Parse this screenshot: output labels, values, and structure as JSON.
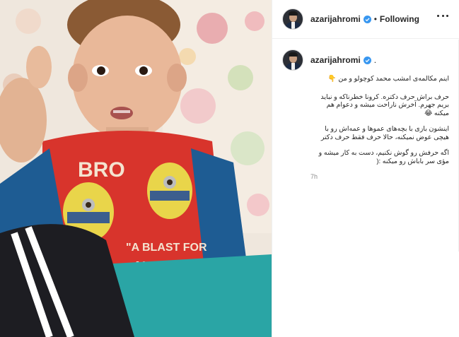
{
  "header": {
    "username": "azarijahromi",
    "separator": "•",
    "follow_status": "Following"
  },
  "post": {
    "username": "azarijahromi",
    "trailing_period": ".",
    "caption": [
      "اینم مکالمه‌ی امشب محمد کوچولو و من 👇",
      "حرف براش حرف دکتره. کرونا خطرناکه و نباید بریم جهرم. آخرش ناراحت میشه و دعوام هم میکنه 😂",
      "اینشون بازی با بچه‌های عموها و عمه‌اش رو با هیچی عوض نمیکنه، حالا حرف فقط حرف دکتر",
      "اگه حرفش رو گوش نکنیم، دست به کار میشه و مؤی سر باباش رو میکنه :("
    ],
    "timestamp": "7h"
  },
  "media": {
    "shirt_text_top": "BRO",
    "shirt_text_bottom_1": "\"A BLAST FOR",
    "shirt_text_bottom_2": "ALL AGES!\""
  },
  "colors": {
    "verified_blue": "#3897f0",
    "shirt_red": "#d8342c",
    "sleeve_blue": "#1e5c93",
    "pants_teal": "#2aa5a5"
  }
}
